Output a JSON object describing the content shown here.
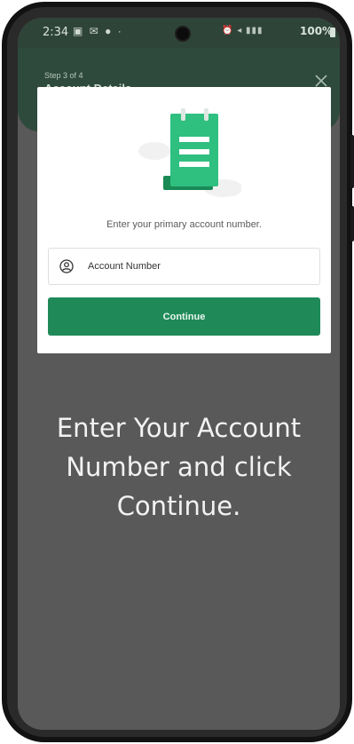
{
  "status_bar": {
    "time": "2:34",
    "battery": "100%",
    "icons": [
      "gallery-icon",
      "mail-icon",
      "chat-icon",
      "alarm-icon",
      "volume-icon",
      "signal-icon",
      "battery-icon"
    ]
  },
  "header": {
    "step": "Step 3 of 4",
    "title": "Account Details"
  },
  "card": {
    "prompt": "Enter your primary account number.",
    "account_field": {
      "placeholder": "Account Number",
      "value": ""
    },
    "continue_label": "Continue"
  },
  "overlay": {
    "line1": "Enter Your Account",
    "line2": "Number and click",
    "line3": "Continue."
  },
  "colors": {
    "brand_green": "#1f8a58",
    "header_green": "#2e4a3c",
    "overlay": "#595959"
  }
}
